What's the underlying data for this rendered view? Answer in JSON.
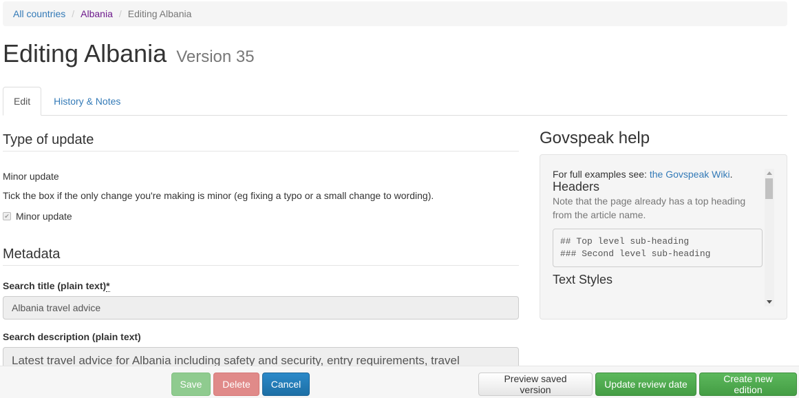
{
  "breadcrumb": {
    "items": [
      "All countries",
      "Albania",
      "Editing Albania"
    ],
    "separator": "/"
  },
  "page": {
    "title": "Editing Albania",
    "version": "Version 35"
  },
  "tabs": [
    {
      "label": "Edit",
      "active": true
    },
    {
      "label": "History & Notes",
      "active": false
    }
  ],
  "type_of_update": {
    "heading": "Type of update",
    "label": "Minor update",
    "hint": "Tick the box if the only change you're making is minor (eg fixing a typo or a small change to wording).",
    "checkbox_label": "Minor update",
    "checkbox_checked": true,
    "checkbox_glyph": "✔"
  },
  "metadata": {
    "heading": "Metadata",
    "search_title_label": "Search title (plain text)",
    "required_marker": "*",
    "search_title_value": "Albania travel advice",
    "search_description_label": "Search description (plain text)",
    "search_description_value": "Latest travel advice for Albania including safety and security, entry requirements, travel"
  },
  "help": {
    "title": "Govspeak help",
    "intro_text": "For full examples see: ",
    "intro_link": "the Govspeak Wiki",
    "intro_end": ".",
    "headers_heading": "Headers",
    "headers_note": "Note that the page already has a top heading from the article name.",
    "code_lines": [
      "## Top level sub-heading",
      "### Second level sub-heading"
    ],
    "text_styles_heading": "Text Styles"
  },
  "footer": {
    "save": "Save",
    "delete": "Delete",
    "cancel": "Cancel",
    "preview": "Preview saved version",
    "update_review": "Update review date",
    "create_edition": "Create new edition"
  }
}
